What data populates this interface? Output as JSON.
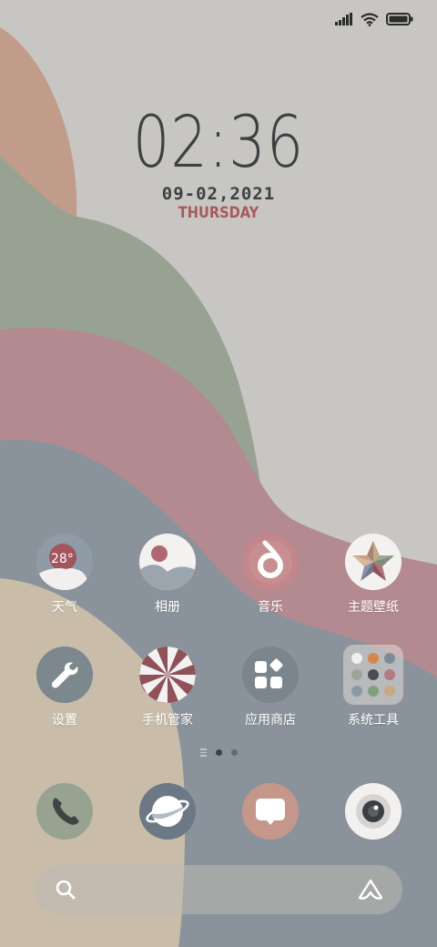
{
  "wallpaper": {
    "colors": {
      "base": "#c8c6c2",
      "terracotta": "#c29c8b",
      "sage": "#98a292",
      "rose": "#b38a8f",
      "slate": "#8a939b",
      "sand": "#c9bdaa"
    }
  },
  "status_bar": {
    "icons": [
      "signal-icon",
      "wifi-icon",
      "battery-icon"
    ]
  },
  "clock": {
    "time": "02:36",
    "date": "09-02,2021",
    "day": "THURSDAY"
  },
  "apps_row1": [
    {
      "label": "天气",
      "icon": "weather-icon",
      "temp": "28°"
    },
    {
      "label": "相册",
      "icon": "gallery-icon"
    },
    {
      "label": "音乐",
      "icon": "music-icon"
    },
    {
      "label": "主题壁纸",
      "icon": "themes-icon"
    }
  ],
  "apps_row2": [
    {
      "label": "设置",
      "icon": "settings-icon"
    },
    {
      "label": "手机管家",
      "icon": "security-icon"
    },
    {
      "label": "应用商店",
      "icon": "app-store-icon"
    },
    {
      "label": "系统工具",
      "icon": "system-tools-folder-icon"
    }
  ],
  "page_indicator": {
    "pages": 2,
    "current": 1
  },
  "dock": [
    {
      "icon": "phone-icon"
    },
    {
      "icon": "browser-icon"
    },
    {
      "icon": "messages-icon"
    },
    {
      "icon": "camera-icon"
    }
  ],
  "search_bar": {
    "placeholder": "",
    "icons": [
      "search-icon",
      "assistant-icon"
    ]
  }
}
